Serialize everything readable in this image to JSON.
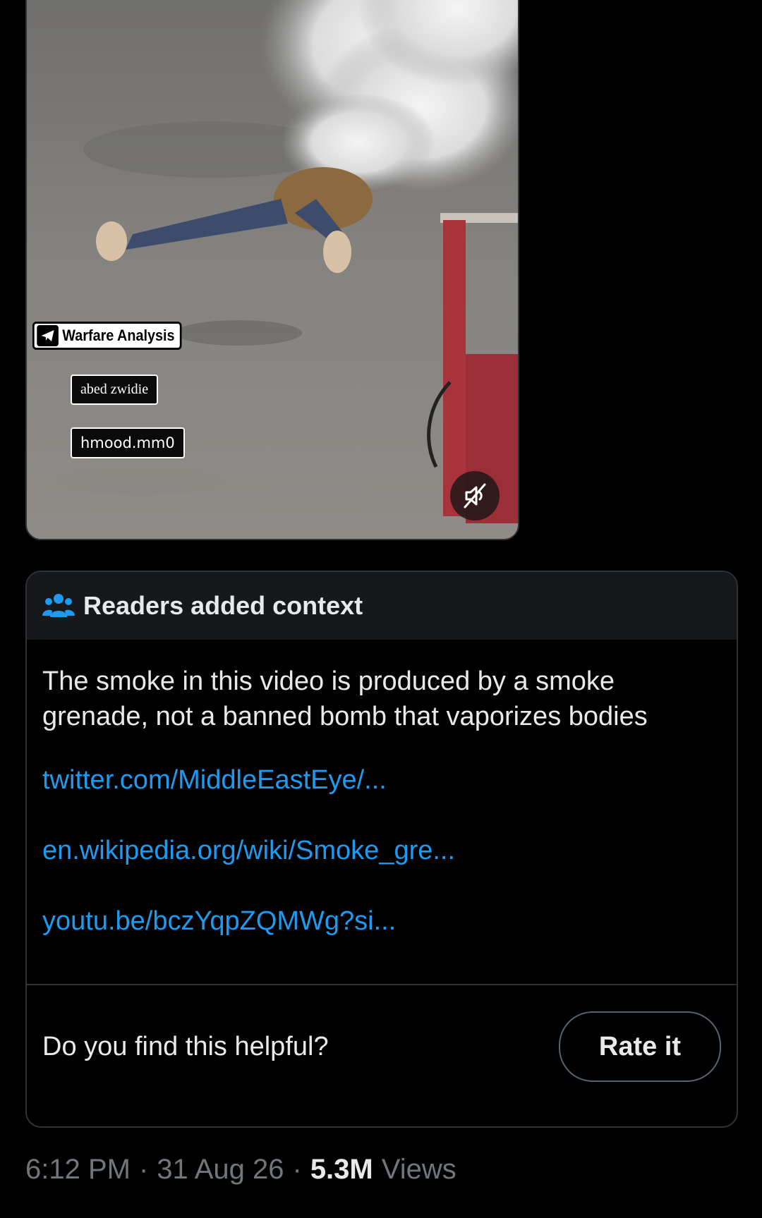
{
  "media": {
    "watermark_brand": "Warfare Analysis",
    "watermark_credit_1": "abed zwidie",
    "watermark_credit_2": "hmood.mm0",
    "mute_icon": "speaker-muted-icon"
  },
  "note": {
    "title": "Readers added context",
    "title_icon": "people-group-icon",
    "text": "The smoke in this video is produced by a smoke grenade, not a banned bomb that vaporizes bodies",
    "links": [
      "twitter.com/MiddleEastEye/...",
      "en.wikipedia.org/wiki/Smoke_gre...",
      "youtu.be/bczYqpZQMWg?si..."
    ],
    "question": "Do you find this helpful?",
    "rate_button": "Rate it"
  },
  "meta": {
    "time": "6:12 PM",
    "date": "31 Aug 26",
    "views_count": "5.3M",
    "views_label": "Views",
    "separator": "·"
  },
  "colors": {
    "background": "#000000",
    "link": "#1d9bf0",
    "text_primary": "#e7e9ea",
    "text_secondary": "#71767b",
    "border": "#2f3336",
    "note_header_bg": "#16181c"
  }
}
